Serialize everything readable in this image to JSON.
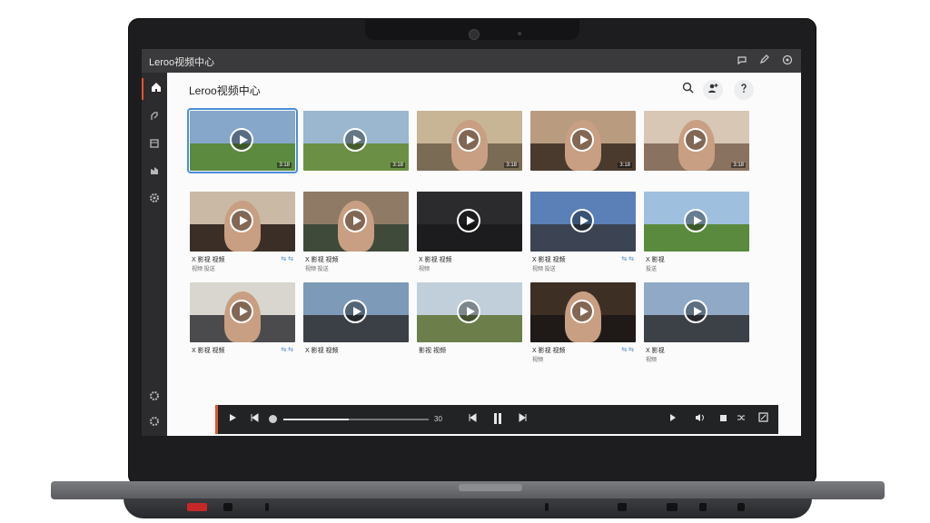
{
  "window": {
    "title": "Leroo视频中心",
    "controls": [
      "comment-icon",
      "edit-icon",
      "settings-icon"
    ]
  },
  "header": {
    "title": "Leroo视频中心",
    "actions": [
      {
        "name": "search-icon"
      },
      {
        "name": "add-user-icon"
      },
      {
        "name": "help-icon"
      }
    ]
  },
  "sidebar": {
    "items": [
      "home-icon",
      "link-icon",
      "folder-icon",
      "media-icon",
      "gear-icon"
    ],
    "bottom_items": [
      "settings-icon",
      "options-icon"
    ]
  },
  "videos": [
    {
      "duration": "3:18",
      "caption": "",
      "meta": ""
    },
    {
      "duration": "3:18",
      "caption": "",
      "meta": ""
    },
    {
      "duration": "3:18",
      "caption": "",
      "meta": ""
    },
    {
      "duration": "3:18",
      "caption": "",
      "meta": ""
    },
    {
      "duration": "3:18",
      "caption": "",
      "meta": ""
    },
    {
      "duration": "",
      "caption": "X 影视 视频",
      "meta": "视频 投送"
    },
    {
      "duration": "",
      "caption": "X 影视 视频",
      "meta": "视频 投送"
    },
    {
      "duration": "",
      "caption": "X 影视 视频",
      "meta": "视频"
    },
    {
      "duration": "",
      "caption": "X 影视 视频",
      "meta": "视频 投送"
    },
    {
      "duration": "",
      "caption": "X 影视",
      "meta": "投送"
    },
    {
      "duration": "",
      "caption": "X 影视 视频",
      "meta": ""
    },
    {
      "duration": "",
      "caption": "X 影视 视频",
      "meta": ""
    },
    {
      "duration": "",
      "caption": "影视 视频",
      "meta": ""
    },
    {
      "duration": "",
      "caption": "X 影视 视频",
      "meta": "视频"
    },
    {
      "duration": "",
      "caption": "X 影视",
      "meta": "视频"
    }
  ],
  "player": {
    "progress": 0.45,
    "time": "30"
  }
}
